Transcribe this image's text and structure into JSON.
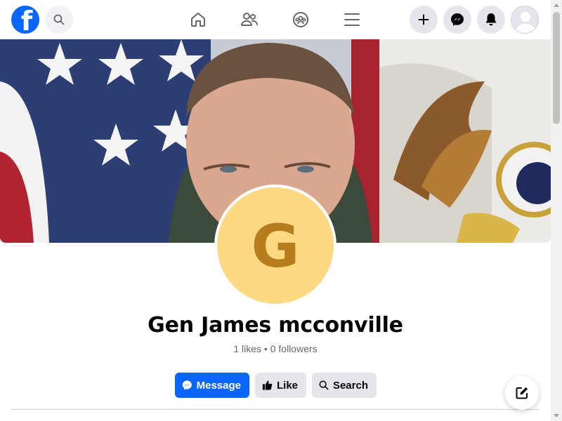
{
  "header": {
    "logo_letter": "f",
    "nav_icons": [
      "home-icon",
      "friends-icon",
      "groups-icon",
      "menu-icon"
    ],
    "action_icons": [
      "plus-icon",
      "messenger-icon",
      "bell-icon",
      "avatar"
    ]
  },
  "profile": {
    "initial": "G",
    "name": "Gen James mcconville",
    "stats": "1 likes • 0 followers"
  },
  "actions": {
    "message_label": "Message",
    "like_label": "Like",
    "search_label": "Search"
  },
  "colors": {
    "brand": "#0866ff",
    "avatar_bg": "#fcd982",
    "avatar_letter": "#b77c1c",
    "button_secondary": "#e4e6eb"
  }
}
